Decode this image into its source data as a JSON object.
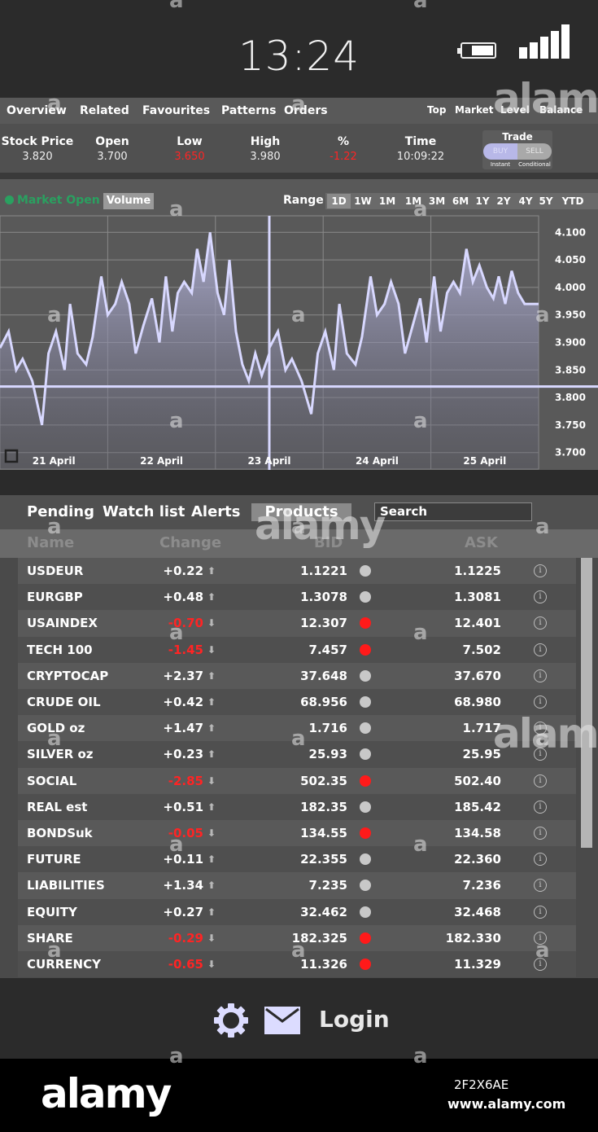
{
  "status_bar": {
    "time": "13:24",
    "icons": [
      "battery-icon",
      "signal-icon"
    ]
  },
  "top_nav": {
    "items": [
      "Overview",
      "Related",
      "Favourites",
      "Patterns",
      "Orders"
    ],
    "right_items": [
      "Top",
      "Market",
      "Level",
      "Balance"
    ]
  },
  "quote": {
    "stock_price": {
      "label": "Stock Price",
      "value": "3.820"
    },
    "open": {
      "label": "Open",
      "value": "3.700"
    },
    "low": {
      "label": "Low",
      "value": "3.650"
    },
    "high": {
      "label": "High",
      "value": "3.980"
    },
    "change_pct": {
      "label": "%",
      "value": "-1.22"
    },
    "time": {
      "label": "Time",
      "value": "10:09:22"
    }
  },
  "trade": {
    "label": "Trade",
    "buy": "BUY",
    "sell": "SELL",
    "instant": "Instant",
    "conditional": "Conditional"
  },
  "chart_header": {
    "market_status": "Market Open",
    "volume_button": "Volume",
    "range_label": "Range",
    "ranges": [
      "1D",
      "1W",
      "1M",
      "1M",
      "3M",
      "6M",
      "1Y",
      "2Y",
      "4Y",
      "5Y",
      "YTD"
    ],
    "selected_range": "1D"
  },
  "colors": {
    "line": "#d8d8ff",
    "market_open": "#2aa060",
    "negative": "#ff2424",
    "dot_red": "#ff1a1a",
    "dot_gray": "#c8c8c8"
  },
  "chart_data": {
    "type": "area",
    "title": "",
    "xlabel": "",
    "ylabel": "",
    "x_tick_labels": [
      "21 April",
      "22 April",
      "23 April",
      "24 April",
      "25 April"
    ],
    "y_tick_labels": [
      "4.100",
      "4.050",
      "4.000",
      "3.950",
      "3.900",
      "3.850",
      "3.800",
      "3.750",
      "3.700"
    ],
    "ylim": [
      3.67,
      4.13
    ],
    "xlim": [
      0,
      5
    ],
    "reference_price": 3.82,
    "crosshair_x": 2.5,
    "grid": true,
    "series": [
      {
        "x": [
          0,
          0.08,
          0.15,
          0.21,
          0.3,
          0.39,
          0.45,
          0.52,
          0.6,
          0.65,
          0.72,
          0.8,
          0.86,
          0.94,
          1.0,
          1.07,
          1.13,
          1.2,
          1.26,
          1.33,
          1.41,
          1.48,
          1.54,
          1.6,
          1.65,
          1.71,
          1.78,
          1.83,
          1.89,
          1.95,
          2.02,
          2.08,
          2.13,
          2.19,
          2.25,
          2.31,
          2.37,
          2.43,
          2.5,
          2.5,
          2.58,
          2.65,
          2.71,
          2.8,
          2.89,
          2.95,
          3.02,
          3.1,
          3.15,
          3.22,
          3.3,
          3.36,
          3.44,
          3.5,
          3.57,
          3.63,
          3.7,
          3.76,
          3.83,
          3.9,
          3.96,
          4.03,
          4.09,
          4.15,
          4.21,
          4.27,
          4.33,
          4.39,
          4.45,
          4.52,
          4.58,
          4.63,
          4.69,
          4.75,
          4.81,
          4.87,
          4.93,
          5.0
        ],
        "y": [
          3.89,
          3.92,
          3.85,
          3.87,
          3.83,
          3.75,
          3.88,
          3.92,
          3.85,
          3.97,
          3.88,
          3.86,
          3.91,
          4.02,
          3.95,
          3.97,
          4.01,
          3.97,
          3.88,
          3.93,
          3.98,
          3.9,
          4.02,
          3.92,
          3.99,
          4.01,
          3.99,
          4.07,
          4.01,
          4.1,
          3.99,
          3.95,
          4.05,
          3.92,
          3.86,
          3.83,
          3.88,
          3.84,
          3.88,
          3.89,
          3.92,
          3.85,
          3.87,
          3.83,
          3.77,
          3.88,
          3.92,
          3.85,
          3.97,
          3.88,
          3.86,
          3.91,
          4.02,
          3.95,
          3.97,
          4.01,
          3.97,
          3.88,
          3.93,
          3.98,
          3.9,
          4.02,
          3.92,
          3.99,
          4.01,
          3.99,
          4.07,
          4.01,
          4.04,
          4.0,
          3.98,
          4.02,
          3.97,
          4.03,
          3.99,
          3.97,
          3.97,
          3.97
        ]
      }
    ]
  },
  "list_tabs": [
    "Pending",
    "Watch list",
    "Alerts",
    "Products"
  ],
  "active_tab": "Products",
  "search": {
    "placeholder": "Search"
  },
  "table": {
    "headers": [
      "Name",
      "Change",
      "BID",
      "ASK"
    ],
    "rows": [
      {
        "name": "USDEUR",
        "change": "+0.22",
        "bid": "1.1221",
        "ask": "1.1225",
        "dir": "up"
      },
      {
        "name": "EURGBP",
        "change": "+0.48",
        "bid": "1.3078",
        "ask": "1.3081",
        "dir": "up"
      },
      {
        "name": "USAINDEX",
        "change": "-0.70",
        "bid": "12.307",
        "ask": "12.401",
        "dir": "down"
      },
      {
        "name": "TECH 100",
        "change": "-1.45",
        "bid": "7.457",
        "ask": "7.502",
        "dir": "down"
      },
      {
        "name": "CRYPTOCAP",
        "change": "+2.37",
        "bid": "37.648",
        "ask": "37.670",
        "dir": "up"
      },
      {
        "name": "CRUDE OIL",
        "change": "+0.42",
        "bid": "68.956",
        "ask": "68.980",
        "dir": "up"
      },
      {
        "name": "GOLD oz",
        "change": "+1.47",
        "bid": "1.716",
        "ask": "1.717",
        "dir": "up"
      },
      {
        "name": "SILVER oz",
        "change": "+0.23",
        "bid": "25.93",
        "ask": "25.95",
        "dir": "up"
      },
      {
        "name": "SOCIAL",
        "change": "-2.85",
        "bid": "502.35",
        "ask": "502.40",
        "dir": "down"
      },
      {
        "name": "REAL est",
        "change": "+0.51",
        "bid": "182.35",
        "ask": "185.42",
        "dir": "up"
      },
      {
        "name": "BONDSuk",
        "change": "-0.05",
        "bid": "134.55",
        "ask": "134.58",
        "dir": "down"
      },
      {
        "name": "FUTURE",
        "change": "+0.11",
        "bid": "22.355",
        "ask": "22.360",
        "dir": "up"
      },
      {
        "name": "LIABILITIES",
        "change": "+1.34",
        "bid": "7.235",
        "ask": "7.236",
        "dir": "up"
      },
      {
        "name": "EQUITY",
        "change": "+0.27",
        "bid": "32.462",
        "ask": "32.468",
        "dir": "up"
      },
      {
        "name": "SHARE",
        "change": "-0.29",
        "bid": "182.325",
        "ask": "182.330",
        "dir": "down"
      },
      {
        "name": "CURRENCY",
        "change": "-0.65",
        "bid": "11.326",
        "ask": "11.329",
        "dir": "down"
      }
    ]
  },
  "footer": {
    "login": "Login",
    "icons": [
      "gear-icon",
      "mail-icon"
    ]
  },
  "watermark": {
    "logo": "alamy",
    "small_mark": "a",
    "image_id": "2F2X6AE",
    "url": "www.alamy.com"
  }
}
